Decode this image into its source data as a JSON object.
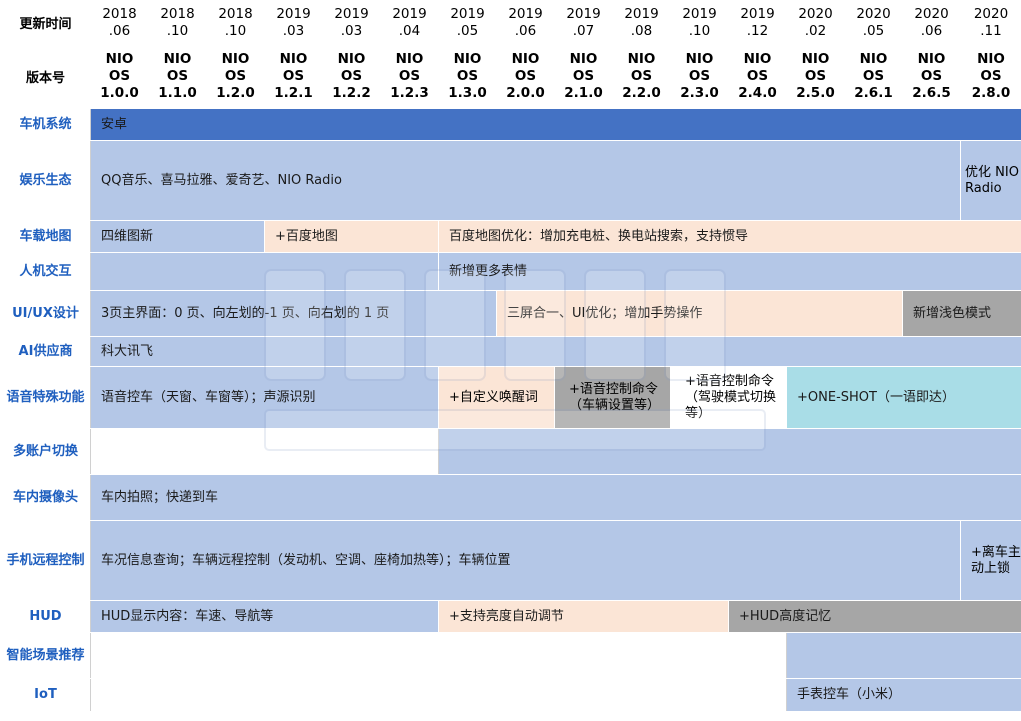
{
  "header": {
    "time_label": "更新时间",
    "version_label": "版本号",
    "columns": [
      {
        "date": [
          "2018",
          ".06"
        ],
        "version": [
          "NIO",
          "OS",
          "1.0.0"
        ]
      },
      {
        "date": [
          "2018",
          ".10"
        ],
        "version": [
          "NIO",
          "OS",
          "1.1.0"
        ]
      },
      {
        "date": [
          "2018",
          ".10"
        ],
        "version": [
          "NIO",
          "OS",
          "1.2.0"
        ]
      },
      {
        "date": [
          "2019",
          ".03"
        ],
        "version": [
          "NIO",
          "OS",
          "1.2.1"
        ]
      },
      {
        "date": [
          "2019",
          ".03"
        ],
        "version": [
          "NIO",
          "OS",
          "1.2.2"
        ]
      },
      {
        "date": [
          "2019",
          ".04"
        ],
        "version": [
          "NIO",
          "OS",
          "1.2.3"
        ]
      },
      {
        "date": [
          "2019",
          ".05"
        ],
        "version": [
          "NIO",
          "OS",
          "1.3.0"
        ]
      },
      {
        "date": [
          "2019",
          ".06"
        ],
        "version": [
          "NIO",
          "OS",
          "2.0.0"
        ]
      },
      {
        "date": [
          "2019",
          ".07"
        ],
        "version": [
          "NIO",
          "OS",
          "2.1.0"
        ]
      },
      {
        "date": [
          "2019",
          ".08"
        ],
        "version": [
          "NIO",
          "OS",
          "2.2.0"
        ]
      },
      {
        "date": [
          "2019",
          ".10"
        ],
        "version": [
          "NIO",
          "OS",
          "2.3.0"
        ]
      },
      {
        "date": [
          "2019",
          ".12"
        ],
        "version": [
          "NIO",
          "OS",
          "2.4.0"
        ]
      },
      {
        "date": [
          "2020",
          ".02"
        ],
        "version": [
          "NIO",
          "OS",
          "2.5.0"
        ]
      },
      {
        "date": [
          "2020",
          ".05"
        ],
        "version": [
          "NIO",
          "OS",
          "2.6.1"
        ]
      },
      {
        "date": [
          "2020",
          ".06"
        ],
        "version": [
          "NIO",
          "OS",
          "2.6.5"
        ]
      },
      {
        "date": [
          "2020",
          ".11"
        ],
        "version": [
          "NIO",
          "OS",
          "2.8.0"
        ]
      }
    ]
  },
  "rows": {
    "os": {
      "label": "车机系统",
      "c1": "安卓"
    },
    "ent": {
      "label": "娱乐生态",
      "c1": "QQ音乐、喜马拉雅、爱奇艺、NIO Radio",
      "c2": "优化 NIO Radio"
    },
    "map": {
      "label": "车载地图",
      "c1": "四维图新",
      "c2": "+百度地图",
      "c3": "百度地图优化：增加充电桩、换电站搜索，支持惯导"
    },
    "hmi": {
      "label": "人机交互",
      "c1": "新增更多表情"
    },
    "ui": {
      "label": "UI/UX设计",
      "c1": "3页主界面：0 页、向左划的-1 页、向右划的 1 页",
      "c2": "三屏合一、UI优化；增加手势操作",
      "c3": "新增浅色模式"
    },
    "ai": {
      "label": "AI供应商",
      "c1": "科大讯飞"
    },
    "voice": {
      "label": "语音特殊功能",
      "c1": "语音控车（天窗、车窗等）；声源识别",
      "c2": "+自定义唤醒词",
      "c3": "+语音控制命令（车辆设置等）",
      "c4": "+语音控制命令（驾驶模式切换等）",
      "c5": "+ONE-SHOT（一语即达）"
    },
    "multi": {
      "label": "多账户切换"
    },
    "camera": {
      "label": "车内摄像头",
      "c1": "车内拍照；快递到车"
    },
    "remote": {
      "label": "手机远程控制",
      "c1": "车况信息查询；车辆远程控制（发动机、空调、座椅加热等）；车辆位置",
      "c2": "+离车主动上锁"
    },
    "hud": {
      "label": "HUD",
      "c1": "HUD显示内容：车速、导航等",
      "c2": "+支持亮度自动调节",
      "c3": "+HUD高度记忆"
    },
    "scene": {
      "label": "智能场景推荐"
    },
    "iot": {
      "label": "IoT",
      "c1": "手表控车（小米）"
    }
  },
  "colors": {
    "label_text": "#1f5fbf",
    "dark_blue": "#4472c4",
    "light_blue": "#b4c7e7",
    "peach": "#fbe5d6",
    "gray": "#a6a6a6",
    "cyan": "#a9dde7"
  }
}
